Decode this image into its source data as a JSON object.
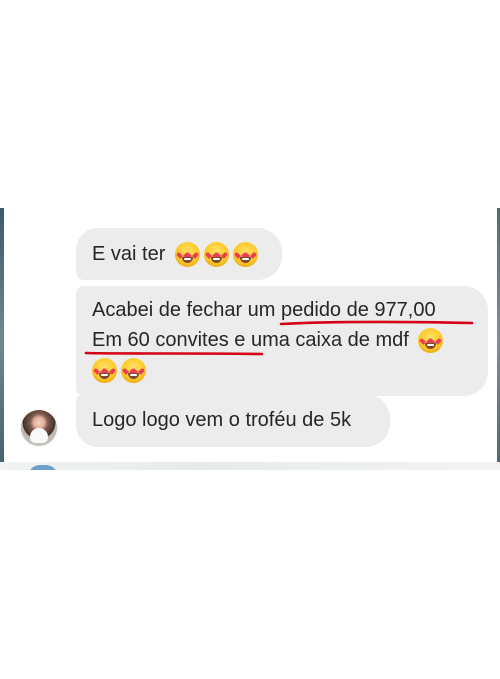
{
  "chat": {
    "messages": [
      {
        "text": "E vai ter",
        "emoji_names": [
          "heart-eyes-emoji",
          "heart-eyes-emoji",
          "heart-eyes-emoji"
        ]
      },
      {
        "line1_prefix": "Acabei de fechar um ",
        "line1_marked": "pedido de 977,00",
        "line2_marked": "Em 60 convites",
        "line2_suffix": " e uma caixa de mdf",
        "emoji_names": [
          "heart-eyes-emoji",
          "heart-eyes-emoji",
          "heart-eyes-emoji"
        ]
      },
      {
        "text": "Logo logo vem o troféu de 5k"
      }
    ],
    "avatar_name": "avatar"
  },
  "colors": {
    "bubble": "#ececec",
    "text": "#262626",
    "underline": "#d40017"
  }
}
